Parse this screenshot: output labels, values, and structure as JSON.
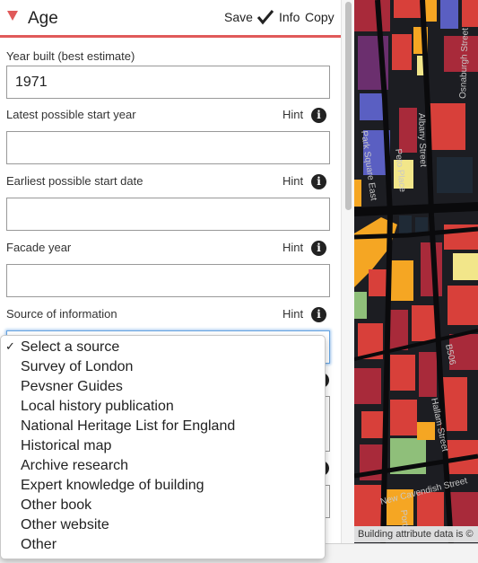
{
  "header": {
    "title": "Age",
    "save_label": "Save",
    "info_label": "Info",
    "copy_label": "Copy"
  },
  "fields": {
    "year_built": {
      "label": "Year built (best estimate)",
      "value": "1971"
    },
    "latest_start": {
      "label": "Latest possible start year",
      "value": "",
      "hint": "Hint"
    },
    "earliest_start": {
      "label": "Earliest possible start date",
      "value": "",
      "hint": "Hint"
    },
    "facade_year": {
      "label": "Facade year",
      "value": "",
      "hint": "Hint"
    },
    "source": {
      "label": "Source of information",
      "hint": "Hint"
    }
  },
  "dropdown": {
    "options": [
      "Select a source",
      "Survey of London",
      "Pevsner Guides",
      "Local history publication",
      "National Heritage List for England",
      "Historical map",
      "Archive research",
      "Expert knowledge of building",
      "Other book",
      "Other website",
      "Other"
    ],
    "check_mark": "✓"
  },
  "map": {
    "streets": [
      "Albany Street",
      "Osnaburgh Street",
      "Park Square East",
      "Peto Place",
      "B506",
      "Hallam Street",
      "New Cavendish Street",
      "Port"
    ],
    "attribution": "Building attribute data is ©"
  },
  "colors": {
    "accent": "#e05a5a",
    "focus": "#66a3e0",
    "map_bg": "#1c1d22",
    "map_red": "#d8403a",
    "map_dark_red": "#a82a3a",
    "map_orange": "#f5a623",
    "map_yellow": "#f2e68a",
    "map_blue": "#5a5fc2",
    "map_green": "#8fbf7a",
    "map_purple": "#6b2f6e"
  }
}
